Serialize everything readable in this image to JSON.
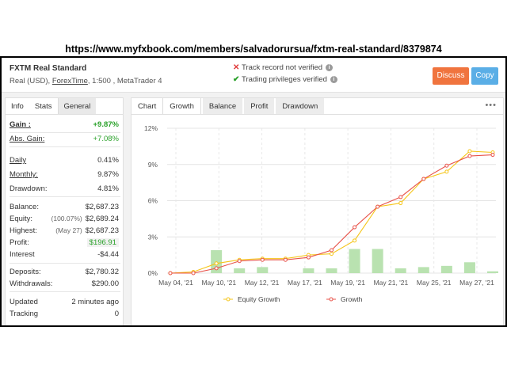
{
  "caption": "https://www.myfxbook.com/members/salvadorursua/fxtm-real-standard/8379874",
  "header": {
    "account_name": "FXTM Real Standard",
    "sub_prefix": "Real (USD),",
    "broker": "ForexTime",
    "sub_suffix": ", 1:500 , MetaTrader 4",
    "status_track": "Track record not verified",
    "status_trading": "Trading privileges verified",
    "discuss": "Discuss",
    "copy": "Copy"
  },
  "left": {
    "tabs": [
      "Info",
      "Stats",
      "General"
    ],
    "gain_label": "Gain :",
    "gain": "+9.87%",
    "abs_gain_label": "Abs. Gain:",
    "abs_gain": "+7.08%",
    "daily_label": "Daily",
    "daily": "0.41%",
    "monthly_label": "Monthly:",
    "monthly": "9.87%",
    "drawdown_label": "Drawdown:",
    "drawdown": "4.81%",
    "balance_label": "Balance:",
    "balance": "$2,687.23",
    "equity_label": "Equity:",
    "equity_note": "(100.07%)",
    "equity": "$2,689.24",
    "highest_label": "Highest:",
    "highest_note": "(May 27)",
    "highest": "$2,687.23",
    "profit_label": "Profit:",
    "profit": "$196.91",
    "interest_label": "Interest",
    "interest": "-$4.44",
    "deposits_label": "Deposits:",
    "deposits": "$2,780.32",
    "withdrawals_label": "Withdrawals:",
    "withdrawals": "$290.00",
    "updated_label": "Updated",
    "updated": "2 minutes ago",
    "tracking_label": "Tracking",
    "tracking": "0"
  },
  "chart_tabs": [
    "Chart",
    "Growth",
    "Balance",
    "Profit",
    "Drawdown"
  ],
  "colors": {
    "equity": "#f5c518",
    "growth": "#e8534a",
    "bars": "#b9e2b0",
    "discuss": "#f0743e",
    "copy": "#5aaee6",
    "gain": "#2aa12a"
  },
  "chart_data": {
    "type": "line",
    "x_tick_labels": [
      "May 04, '21",
      "May 10, '21",
      "May 12, '21",
      "May 17, '21",
      "May 19, '21",
      "May 21, '21",
      "May 25, '21",
      "May 27, '21"
    ],
    "y_tick_labels": [
      "0%",
      "3%",
      "6%",
      "9%",
      "12%"
    ],
    "ylim": [
      0,
      12
    ],
    "y_unit": "%",
    "grid": true,
    "legend_position": "bottom",
    "series": [
      {
        "name": "Equity Growth",
        "values": [
          0,
          0.1,
          0.8,
          1.1,
          1.2,
          1.2,
          1.5,
          1.6,
          2.7,
          5.5,
          5.8,
          7.8,
          8.4,
          10.1,
          10.0
        ]
      },
      {
        "name": "Growth",
        "values": [
          0,
          0,
          0.4,
          1.0,
          1.1,
          1.1,
          1.3,
          1.9,
          3.8,
          5.5,
          6.3,
          7.8,
          8.9,
          9.7,
          9.8
        ]
      }
    ],
    "bars": [
      0,
      0,
      1.9,
      0.4,
      0.5,
      0,
      0.4,
      0.4,
      2.0,
      2.0,
      0.4,
      0.5,
      0.6,
      0.9,
      0.15
    ]
  }
}
